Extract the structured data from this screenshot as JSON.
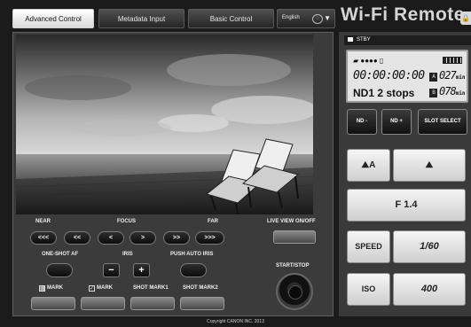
{
  "tabs": [
    {
      "label": "Advanced Control",
      "active": true
    },
    {
      "label": "Metadata Input",
      "active": false
    },
    {
      "label": "Basic Control",
      "active": false
    }
  ],
  "language": {
    "selected": "English",
    "globe_icon": "globe-icon",
    "caret": "▼"
  },
  "brand": "Wi-Fi Remote",
  "controls": {
    "focus": {
      "near_label": "NEAR",
      "focus_label": "FOCUS",
      "far_label": "FAR",
      "buttons": [
        "<<<",
        "<<",
        "<",
        ">",
        ">>",
        ">>>"
      ]
    },
    "live_view_label": "LIVE VIEW ON/OFF",
    "one_shot_af_label": "ONE-SHOT AF",
    "iris": {
      "label": "IRIS",
      "minus": "−",
      "plus": "+"
    },
    "push_auto_iris_label": "PUSH AUTO IRIS",
    "start_stop_label": "START/STOP",
    "marks": {
      "mark1": "MARK",
      "mark2": "MARK",
      "shot_mark1": "SHOT MARK1",
      "shot_mark2": "SHOT MARK2"
    }
  },
  "copyright": "Copyright CANON INC. 2013",
  "status": {
    "mode": "STBY",
    "timecode": "00:00:00:00",
    "nd": "ND1 2 stops",
    "slot_a": {
      "badge": "A",
      "value": "027",
      "unit": "min"
    },
    "slot_b": {
      "badge": "B",
      "value": "078",
      "unit": "min"
    }
  },
  "right_buttons": {
    "nd_minus": "ND -",
    "nd_plus": "ND +",
    "slot_select": "SLOT SELECT"
  },
  "camera_settings": {
    "wb_auto": "A",
    "aperture": "F 1.4",
    "speed_label": "SPEED",
    "speed_value": "1/60",
    "iso_label": "ISO",
    "iso_value": "400"
  }
}
